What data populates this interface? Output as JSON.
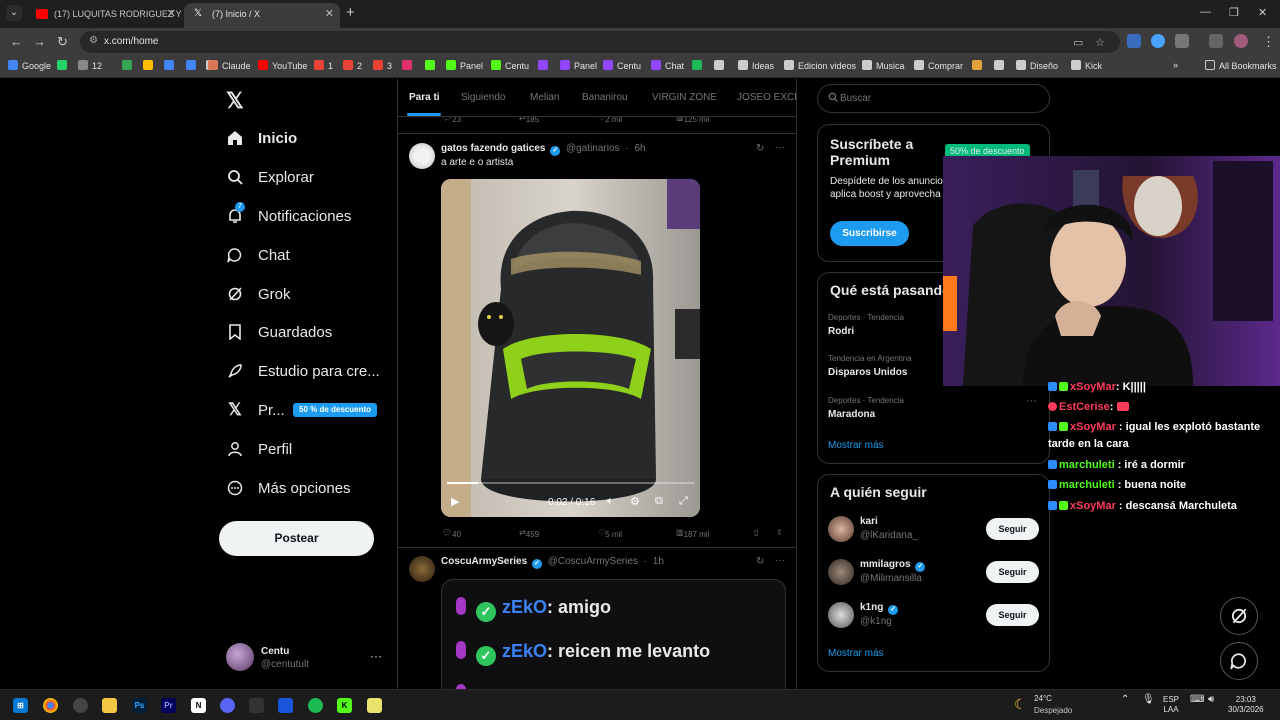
{
  "browser": {
    "tabs": [
      {
        "title": "(17) LUQUITAS RODRIGUEZ Y L",
        "favicon_color": "#ff0000"
      },
      {
        "title": "(7) Inicio / X",
        "favicon_color": "#ffffff"
      }
    ],
    "url": "x.com/home",
    "bookmarks": [
      {
        "label": "Google",
        "color": "#4285f4"
      },
      {
        "label": "",
        "color": "#25d366"
      },
      {
        "label": "12",
        "color": "#888888"
      },
      {
        "label": "",
        "color": "#34a853"
      },
      {
        "label": "",
        "color": "#fbbc04"
      },
      {
        "label": "",
        "color": "#4285f4"
      },
      {
        "label": "",
        "color": "#4285f4"
      },
      {
        "label": "",
        "color": "#cccccc"
      },
      {
        "label": "Claude",
        "color": "#d97757"
      },
      {
        "label": "YouTube",
        "color": "#ff0000"
      },
      {
        "label": "1",
        "color": "#ea4335"
      },
      {
        "label": "2",
        "color": "#ea4335"
      },
      {
        "label": "3",
        "color": "#ea4335"
      },
      {
        "label": "",
        "color": "#e1306c"
      },
      {
        "label": "",
        "color": "#53fc18"
      },
      {
        "label": "Panel",
        "color": "#53fc18"
      },
      {
        "label": "Centu",
        "color": "#53fc18"
      },
      {
        "label": "",
        "color": "#9146ff"
      },
      {
        "label": "Panel",
        "color": "#9146ff"
      },
      {
        "label": "Centu",
        "color": "#9146ff"
      },
      {
        "label": "Chat",
        "color": "#9146ff"
      },
      {
        "label": "",
        "color": "#1db954"
      },
      {
        "label": "",
        "color": "#cccccc"
      },
      {
        "label": "Ideas",
        "color": "#cccccc"
      },
      {
        "label": "Edicion videos",
        "color": "#cccccc"
      },
      {
        "label": "Musica",
        "color": "#cccccc"
      },
      {
        "label": "Comprar",
        "color": "#cccccc"
      },
      {
        "label": "",
        "color": "#e3a33a"
      },
      {
        "label": "",
        "color": "#cccccc"
      },
      {
        "label": "Diseño",
        "color": "#cccccc"
      },
      {
        "label": "Kick",
        "color": "#cccccc"
      }
    ],
    "all_bookmarks": "All Bookmarks"
  },
  "sidebar": {
    "items": [
      {
        "label": "Inicio",
        "icon": "home-icon"
      },
      {
        "label": "Explorar",
        "icon": "search-icon"
      },
      {
        "label": "Notificaciones",
        "icon": "bell-icon",
        "badge": "7"
      },
      {
        "label": "Chat",
        "icon": "chat-icon"
      },
      {
        "label": "Grok",
        "icon": "grok-icon"
      },
      {
        "label": "Guardados",
        "icon": "bookmark-icon"
      },
      {
        "label": "Estudio para cre...",
        "icon": "rocket-icon"
      },
      {
        "label": "Pr...",
        "icon": "x-premium-icon"
      },
      {
        "label": "Perfil",
        "icon": "person-icon"
      },
      {
        "label": "Más opciones",
        "icon": "more-circle-icon"
      }
    ],
    "premium_badge": "50 % de descuento",
    "post_button": "Postear",
    "account": {
      "name": "Centu",
      "handle": "@centutult"
    }
  },
  "feed": {
    "tabs": [
      "Para ti",
      "Siguiendo",
      "Melian",
      "Bananirou",
      "VIRGIN ZONE",
      "JOSEO EXCL"
    ],
    "prev_actions": {
      "replies": "23",
      "reposts": "185",
      "likes": "2 mil",
      "views": "125 mil"
    },
    "tweet1": {
      "name": "gatos fazendo gatices",
      "handle": "@gatinarios",
      "time": "6h",
      "text": "a arte e o artista",
      "video_time": "0:02 / 0:16",
      "video_progress": 0.125,
      "replies": "40",
      "reposts": "459",
      "likes": "5 mil",
      "views": "187 mil"
    },
    "tweet2": {
      "name": "CoscuArmySeries",
      "handle": "@CoscuArmySeries",
      "time": "1h",
      "lines": [
        {
          "user": "zEkO",
          "text": ": amigo"
        },
        {
          "user": "zEkO",
          "text": ": reicen me levanto"
        }
      ]
    }
  },
  "right": {
    "search_placeholder": "Buscar",
    "premium": {
      "title": "Suscríbete a Premium",
      "text": "Despídete de los anuncios, obtén estadísticas, aplica boost y aprovecha más de 20 ca",
      "button": "Suscribirse"
    },
    "trends": {
      "title": "Qué está pasando",
      "items": [
        {
          "category": "Deportes · Tendencia",
          "name": "Rodri"
        },
        {
          "category": "Tendencia en Argentina",
          "name": "Disparos Unidos"
        },
        {
          "category": "Deportes · Tendencia",
          "name": "Maradona"
        }
      ],
      "more": "Mostrar más"
    },
    "who_to_follow": {
      "title": "A quién seguir",
      "users": [
        {
          "name": "kari",
          "handle": "@lKaridana_",
          "verified": false,
          "button": "Seguir"
        },
        {
          "name": "mmilagros",
          "handle": "@Milimansilla",
          "verified": true,
          "button": "Seguir"
        },
        {
          "name": "k1ng",
          "handle": "@k1ng",
          "verified": true,
          "button": "Seguir"
        }
      ],
      "more": "Mostrar más"
    }
  },
  "overlay": {
    "discount_badge": "50% de descuento",
    "chat": [
      {
        "user": "xSoyMar",
        "text": ": K|||||",
        "color": "#ff3b5c"
      },
      {
        "user": "EstCerise",
        "text": ":",
        "color": "#ff3b5c"
      },
      {
        "user": "xSoyMar",
        "text": ": igual les explotó bastante tarde en la cara",
        "color": "#ff3b5c"
      },
      {
        "user": "marchuleti",
        "text": ": iré a dormir",
        "color": "#53fc18"
      },
      {
        "user": "marchuleti",
        "text": ": buena noite",
        "color": "#53fc18"
      },
      {
        "user": "xSoyMar",
        "text": ": descansá Marchuleta",
        "color": "#ff3b5c"
      }
    ]
  },
  "taskbar": {
    "weather_temp": "24°C",
    "weather_desc": "Despejado",
    "lang_top": "ESP",
    "lang_bottom": "LAA",
    "time": "23:03",
    "date": "30/3/2026"
  }
}
